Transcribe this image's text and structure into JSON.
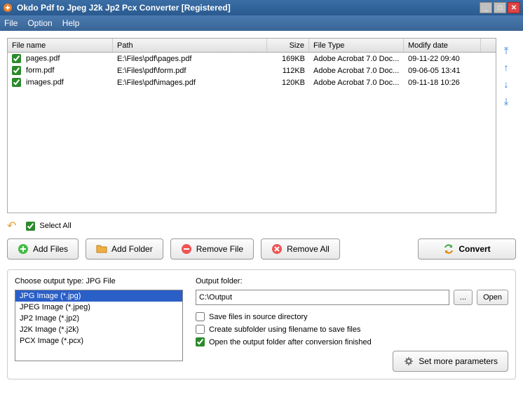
{
  "window": {
    "title": "Okdo Pdf to Jpeg J2k Jp2 Pcx Converter [Registered]"
  },
  "menu": {
    "file": "File",
    "option": "Option",
    "help": "Help"
  },
  "table": {
    "headers": {
      "name": "File name",
      "path": "Path",
      "size": "Size",
      "type": "File Type",
      "date": "Modify date"
    },
    "rows": [
      {
        "name": "pages.pdf",
        "path": "E:\\Files\\pdf\\pages.pdf",
        "size": "169KB",
        "type": "Adobe Acrobat 7.0 Doc...",
        "date": "09-11-22 09:40"
      },
      {
        "name": "form.pdf",
        "path": "E:\\Files\\pdf\\form.pdf",
        "size": "112KB",
        "type": "Adobe Acrobat 7.0 Doc...",
        "date": "09-06-05 13:41"
      },
      {
        "name": "images.pdf",
        "path": "E:\\Files\\pdf\\images.pdf",
        "size": "120KB",
        "type": "Adobe Acrobat 7.0 Doc...",
        "date": "09-11-18 10:26"
      }
    ]
  },
  "selectall": "Select All",
  "buttons": {
    "addfiles": "Add Files",
    "addfolder": "Add Folder",
    "removefile": "Remove File",
    "removeall": "Remove All",
    "convert": "Convert"
  },
  "output": {
    "typelabel": "Choose output type:  JPG File",
    "types": [
      "JPG Image (*.jpg)",
      "JPEG Image (*.jpeg)",
      "JP2 Image (*.jp2)",
      "J2K Image (*.j2k)",
      "PCX Image (*.pcx)"
    ],
    "selected": 0,
    "folderlabel": "Output folder:",
    "folderpath": "C:\\Output",
    "browse": "...",
    "open": "Open",
    "opt1": "Save files in source directory",
    "opt2": "Create subfolder using filename to save files",
    "opt3": "Open the output folder after conversion finished",
    "moreparams": "Set more parameters"
  }
}
